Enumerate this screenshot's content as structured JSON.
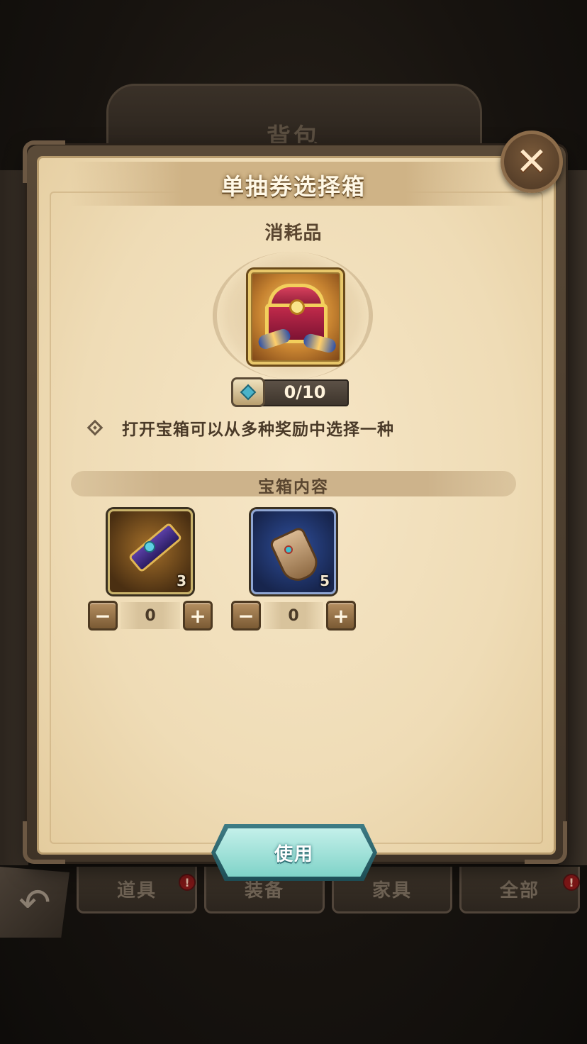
{
  "background": {
    "title": "背包",
    "tabs": [
      {
        "label": "道具",
        "badge": "!"
      },
      {
        "label": "装备",
        "badge": ""
      },
      {
        "label": "家具",
        "badge": ""
      },
      {
        "label": "全部",
        "badge": "!"
      }
    ],
    "back_icon": "back-arrow-icon"
  },
  "dialog": {
    "title": "单抽券选择箱",
    "close_icon": "close-icon",
    "category": "消耗品",
    "item_icon": "treasure-chest-icon",
    "owned_count": "0/10",
    "description": "打开宝箱可以从多种奖励中选择一种",
    "section_title": "宝箱内容",
    "rewards": [
      {
        "icon": "gauntlet-scroll-icon",
        "count": "3",
        "selected": "0",
        "minus": "−",
        "plus": "+",
        "frame_color": "#c9b36b"
      },
      {
        "icon": "hero-scroll-icon",
        "count": "5",
        "selected": "0",
        "minus": "−",
        "plus": "+",
        "frame_color": "#8fa6d3"
      }
    ],
    "use_label": "使用"
  },
  "colors": {
    "panel_bg": "#f2e1bf",
    "use_button": "#9fe0d8",
    "title_text": "#fff8e6"
  }
}
